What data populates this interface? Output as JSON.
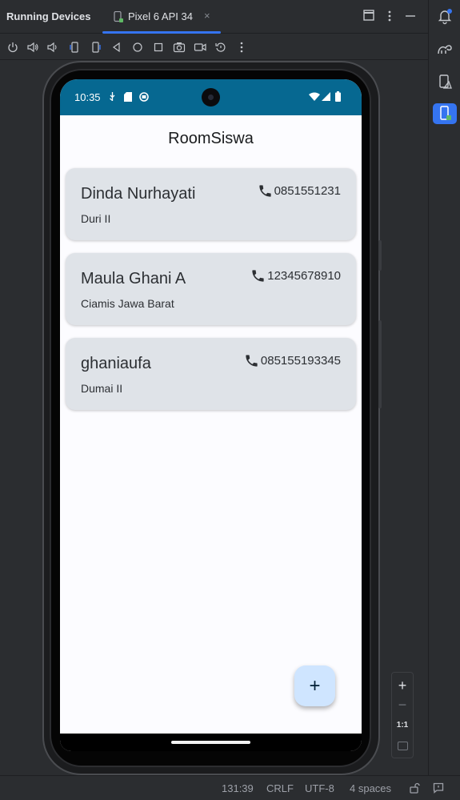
{
  "ide": {
    "tool_window_title": "Running Devices",
    "device_tab": {
      "label": "Pixel 6 API 34",
      "close": "×"
    },
    "toolbar_icons": [
      "power-icon",
      "volume-up-icon",
      "volume-down-icon",
      "rotate-left-icon",
      "rotate-right-icon",
      "back-icon",
      "home-icon",
      "overview-icon",
      "screenshot-icon",
      "screen-record-icon",
      "reset-icon",
      "more-icon"
    ],
    "status_bar": {
      "position": "131:39",
      "line_ending": "CRLF",
      "encoding": "UTF-8",
      "indent": "4 spaces"
    },
    "zoom": {
      "one_to_one": "1:1"
    },
    "accent_color": "#3574f0"
  },
  "phone": {
    "status_time": "10:35",
    "status_bar_color": "#066891",
    "app_title": "RoomSiswa",
    "students": [
      {
        "name": "Dinda Nurhayati",
        "address": "Duri II",
        "phone": "0851551231"
      },
      {
        "name": "Maula Ghani A",
        "address": "Ciamis Jawa Barat",
        "phone": "12345678910"
      },
      {
        "name": "ghaniaufa",
        "address": "Dumai II",
        "phone": "085155193345"
      }
    ],
    "fab_label": "+",
    "fab_color": "#cfe5ff",
    "card_color": "#dfe3e8"
  }
}
